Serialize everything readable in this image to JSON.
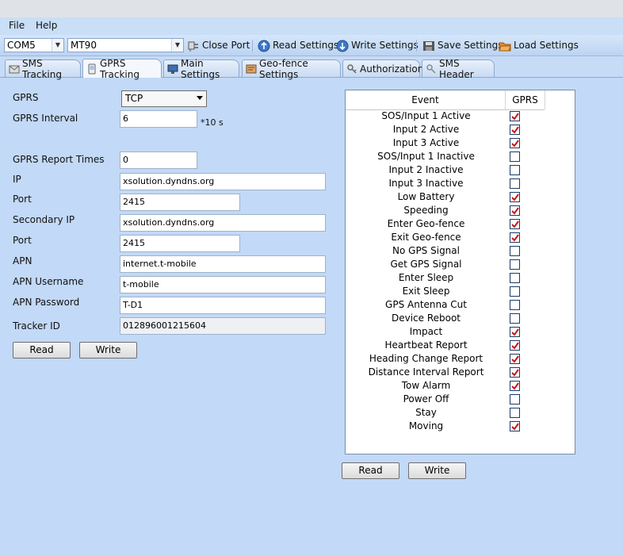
{
  "menu": {
    "file": "File",
    "help": "Help"
  },
  "toolbar": {
    "port": "COM5",
    "device": "MT90",
    "close_port": "Close Port",
    "read_settings": "Read Settings",
    "write_settings": "Write Settings",
    "save_settings": "Save Settings",
    "load_settings": "Load Settings"
  },
  "tabs": [
    {
      "label": "SMS Tracking",
      "icon": "sms-icon"
    },
    {
      "label": "GPRS Tracking",
      "icon": "gprs-icon"
    },
    {
      "label": "Main Settings",
      "icon": "monitor-icon"
    },
    {
      "label": "Geo-fence Settings",
      "icon": "map-icon"
    },
    {
      "label": "Authorization",
      "icon": "key-icon"
    },
    {
      "label": "SMS Header",
      "icon": "header-icon"
    }
  ],
  "active_tab": "GPRS Tracking",
  "form": {
    "gprs_label": "GPRS",
    "gprs_value": "TCP",
    "interval_label": "GPRS Interval",
    "interval_value": "6",
    "interval_unit": "*10 s",
    "report_times_label": "GPRS Report Times",
    "report_times_value": "0",
    "ip_label": "IP",
    "ip_value": "xsolution.dyndns.org",
    "port_label": "Port",
    "port_value": "2415",
    "secondary_ip_label": "Secondary IP",
    "secondary_ip_value": "xsolution.dyndns.org",
    "port2_label": "Port",
    "port2_value": "2415",
    "apn_label": "APN",
    "apn_value": "internet.t-mobile",
    "apn_user_label": "APN Username",
    "apn_user_value": "t-mobile",
    "apn_pass_label": "APN Password",
    "apn_pass_value": "T-D1",
    "tracker_label": "Tracker ID",
    "tracker_value": "012896001215604",
    "read": "Read",
    "write": "Write"
  },
  "events": {
    "col_event": "Event",
    "col_gprs": "GPRS",
    "rows": [
      {
        "name": "SOS/Input 1 Active",
        "checked": true
      },
      {
        "name": "Input 2 Active",
        "checked": true
      },
      {
        "name": "Input 3 Active",
        "checked": true
      },
      {
        "name": "SOS/Input 1 Inactive",
        "checked": false
      },
      {
        "name": "Input 2 Inactive",
        "checked": false
      },
      {
        "name": "Input 3 Inactive",
        "checked": false
      },
      {
        "name": "Low Battery",
        "checked": true
      },
      {
        "name": "Speeding",
        "checked": true
      },
      {
        "name": "Enter Geo-fence",
        "checked": true
      },
      {
        "name": "Exit Geo-fence",
        "checked": true
      },
      {
        "name": "No GPS Signal",
        "checked": false
      },
      {
        "name": "Get GPS Signal",
        "checked": false
      },
      {
        "name": "Enter Sleep",
        "checked": false
      },
      {
        "name": "Exit Sleep",
        "checked": false
      },
      {
        "name": "GPS Antenna Cut",
        "checked": false
      },
      {
        "name": "Device Reboot",
        "checked": false
      },
      {
        "name": "Impact",
        "checked": true
      },
      {
        "name": "Heartbeat Report",
        "checked": true
      },
      {
        "name": "Heading Change Report",
        "checked": true
      },
      {
        "name": "Distance Interval Report",
        "checked": true
      },
      {
        "name": "Tow Alarm",
        "checked": true
      },
      {
        "name": "Power Off",
        "checked": false
      },
      {
        "name": "Stay",
        "checked": false
      },
      {
        "name": "Moving",
        "checked": true
      }
    ],
    "read": "Read",
    "write": "Write"
  },
  "colors": {
    "background": "#c2d9f7",
    "check": "#c4161c"
  }
}
